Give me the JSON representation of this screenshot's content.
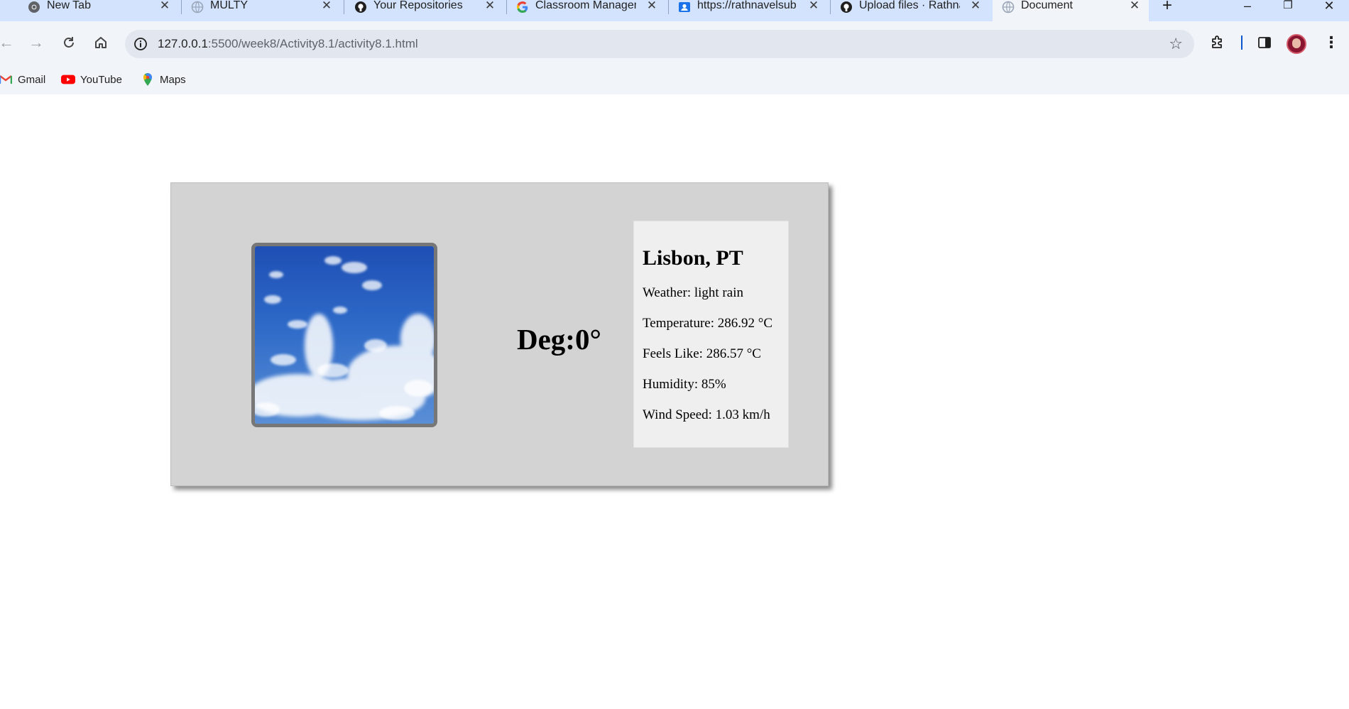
{
  "browser": {
    "tabs": [
      {
        "title": "New Tab",
        "favicon": "chrome-icon",
        "active": false
      },
      {
        "title": "MULTY",
        "favicon": "globe-icon",
        "active": false
      },
      {
        "title": "Your Repositories",
        "favicon": "github-icon",
        "active": false
      },
      {
        "title": "Classroom Managen",
        "favicon": "google-icon",
        "active": false
      },
      {
        "title": "https://rathnavelsub",
        "favicon": "contact-icon",
        "active": false
      },
      {
        "title": "Upload files · Rathna",
        "favicon": "github-icon",
        "active": false
      },
      {
        "title": "Document",
        "favicon": "globe-icon",
        "active": true
      }
    ],
    "new_tab_label": "+",
    "address": {
      "host": "127.0.0.1",
      "path": ":5500/week8/Activity8.1/activity8.1.html"
    },
    "bookmarks": [
      {
        "label": "Gmail",
        "icon": "gmail-icon"
      },
      {
        "label": "YouTube",
        "icon": "youtube-icon"
      },
      {
        "label": "Maps",
        "icon": "maps-icon"
      }
    ]
  },
  "weather": {
    "image": "sky-clouds-image",
    "degree": "Deg:0°",
    "city": "Lisbon, PT",
    "details": [
      "Weather: light rain",
      "Temperature: 286.92 °C",
      "Feels Like: 286.57 °C",
      "Humidity: 85%",
      "Wind Speed: 1.03 km/h"
    ]
  },
  "colors": {
    "chrome_bg": "#d3e3fd",
    "toolbar_bg": "#f1f4f9",
    "card_bg": "#d3d3d3",
    "info_bg": "#efefef",
    "image_border": "#777777"
  }
}
